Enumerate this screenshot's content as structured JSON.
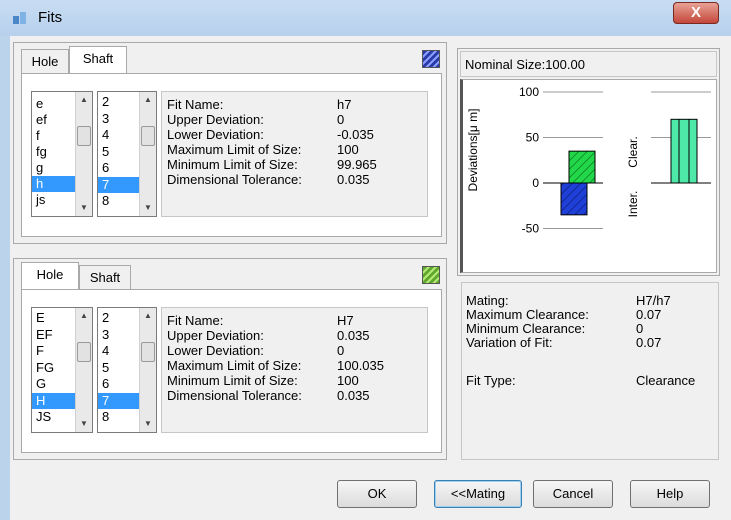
{
  "window": {
    "title": "Fits",
    "close_glyph": "X"
  },
  "top_group": {
    "tabs": [
      "Hole",
      "Shaft"
    ],
    "active_tab": "Shaft",
    "swatch_color": "#2a3aa8",
    "list1": {
      "items": [
        "e",
        "ef",
        "f",
        "fg",
        "g",
        "h",
        "js"
      ],
      "selected": "h"
    },
    "list2": {
      "items": [
        "2",
        "3",
        "4",
        "5",
        "6",
        "7",
        "8"
      ],
      "selected": "7"
    },
    "info": {
      "labels": [
        "Fit Name:",
        "Upper Deviation:",
        "Lower Deviation:",
        "Maximum Limit of Size:",
        "Minimum Limit of Size:",
        "Dimensional Tolerance:"
      ],
      "values": [
        "h7",
        "0",
        "-0.035",
        "100",
        "99.965",
        "0.035"
      ]
    }
  },
  "bottom_group": {
    "tabs": [
      "Hole",
      "Shaft"
    ],
    "active_tab": "Hole",
    "swatch_color": "#7ac142",
    "list1": {
      "items": [
        "E",
        "EF",
        "F",
        "FG",
        "G",
        "H",
        "JS"
      ],
      "selected": "H"
    },
    "list2": {
      "items": [
        "2",
        "3",
        "4",
        "5",
        "6",
        "7",
        "8"
      ],
      "selected": "7"
    },
    "info": {
      "labels": [
        "Fit Name:",
        "Upper Deviation:",
        "Lower Deviation:",
        "Maximum Limit of Size:",
        "Minimum Limit of Size:",
        "Dimensional Tolerance:"
      ],
      "values": [
        "H7",
        "0.035",
        "0",
        "100.035",
        "100",
        "0.035"
      ]
    }
  },
  "nominal_label": "Nominal Size:100.00",
  "chart_data": {
    "type": "bar",
    "ylabel": "Deviations[μ m]",
    "yticks": [
      "100",
      "50",
      "0",
      "-50"
    ],
    "ylim": [
      -60,
      100
    ],
    "bars": [
      {
        "name": "Hole",
        "from": 0,
        "to": 35,
        "color": "#22d84a"
      },
      {
        "name": "Shaft",
        "from": -35,
        "to": 0,
        "color": "#1f3fd9"
      }
    ],
    "fit_zone": {
      "labels": [
        "Clear.",
        "Inter."
      ],
      "from": 0,
      "to": 70,
      "color": "#4ee8a8"
    }
  },
  "mating": {
    "labels": [
      "Mating:",
      "Maximum Clearance:",
      "Minimum Clearance:",
      "Variation of Fit:",
      "Fit Type:"
    ],
    "values": [
      "H7/h7",
      "0.07",
      "0",
      "0.07",
      "Clearance"
    ]
  },
  "buttons": {
    "ok": "OK",
    "mating": "<<Mating",
    "cancel": "Cancel",
    "help": "Help"
  }
}
